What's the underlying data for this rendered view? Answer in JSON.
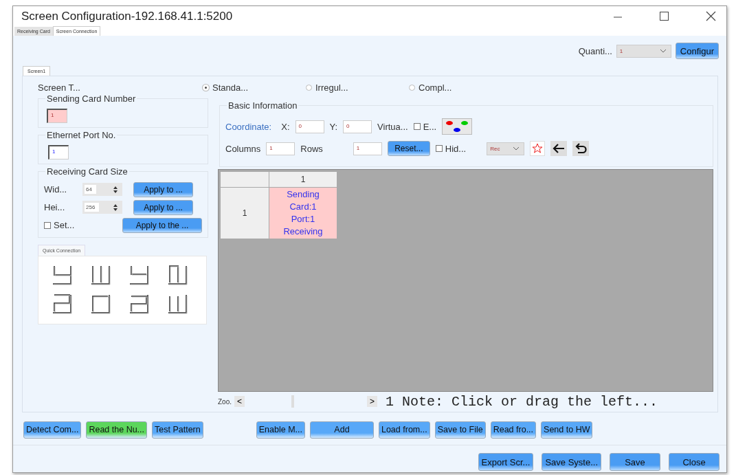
{
  "window": {
    "title": "Screen Configuration-192.168.41.1:5200"
  },
  "tabs": [
    {
      "label": "Receiving Card",
      "selected": false
    },
    {
      "label": "Screen Connection",
      "selected": true
    }
  ],
  "quantity": {
    "label": "Quanti...",
    "value": "1"
  },
  "configure_button": "Configur",
  "screen_tabs": [
    {
      "label": "Screen1",
      "selected": true
    }
  ],
  "screen_type": {
    "label": "Screen T...",
    "options": [
      {
        "label": "Standa...",
        "selected": true
      },
      {
        "label": "Irregul...",
        "selected": false
      },
      {
        "label": "Compl...",
        "selected": false
      }
    ]
  },
  "sending_card": {
    "title": "Sending Card Number",
    "value": "1"
  },
  "ethernet_port": {
    "title": "Ethernet Port No.",
    "value": "1"
  },
  "receiving_card_size": {
    "title": "Receiving Card Size",
    "rows": [
      {
        "label": "Wid...",
        "value": "64",
        "button": "Apply to ..."
      },
      {
        "label": "Hei...",
        "value": "256",
        "button": "Apply to ..."
      }
    ],
    "set": {
      "label": "Set...",
      "checked": false
    },
    "apply_all": "Apply to the ..."
  },
  "quick_connection": {
    "title": "Quick Connection"
  },
  "basic_info": {
    "title": "Basic Information",
    "coordinate_label": "Coordinate:",
    "x_label": "X:",
    "x_value": "0",
    "y_label": "Y:",
    "y_value": "0",
    "virtual_label": "Virtua...",
    "e_checkbox": {
      "label": "E...",
      "checked": false
    },
    "columns_label": "Columns",
    "columns_value": "1",
    "rows_label": "Rows",
    "rows_value": "1",
    "reset_button": "Reset...",
    "hide_checkbox": {
      "label": "Hid...",
      "checked": false
    },
    "mode_select": "Rec"
  },
  "grid": {
    "column_headers": [
      "1"
    ],
    "rows": [
      {
        "header": "1",
        "cells": [
          {
            "text": "Sending\nCard:1\nPort:1\nReceiving",
            "assigned": true
          }
        ]
      }
    ]
  },
  "zoom": {
    "level": 0.4,
    "label": "Zoo.",
    "left": "<",
    "right": ">",
    "page": "1",
    "note": "Note: Click or drag the left..."
  },
  "action_buttons": [
    {
      "label": "Detect Com...",
      "color": "#58a8f8"
    },
    {
      "label": "Read the Nu...",
      "color": "#5cd65c"
    },
    {
      "label": "Test Pattern",
      "color": "#58a8f8"
    },
    {
      "label": "Enable M...",
      "color": "#58a8f8"
    },
    {
      "label": "Add",
      "color": "#58a8f8"
    },
    {
      "label": "Load from...",
      "color": "#58a8f8"
    },
    {
      "label": "Save to File",
      "color": "#58a8f8"
    },
    {
      "label": "Read fro...",
      "color": "#58a8f8"
    },
    {
      "label": "Send to HW",
      "color": "#58a8f8"
    }
  ],
  "dialog_buttons": [
    "Export Scr...",
    "Save Syste...",
    "Save",
    "Close"
  ]
}
